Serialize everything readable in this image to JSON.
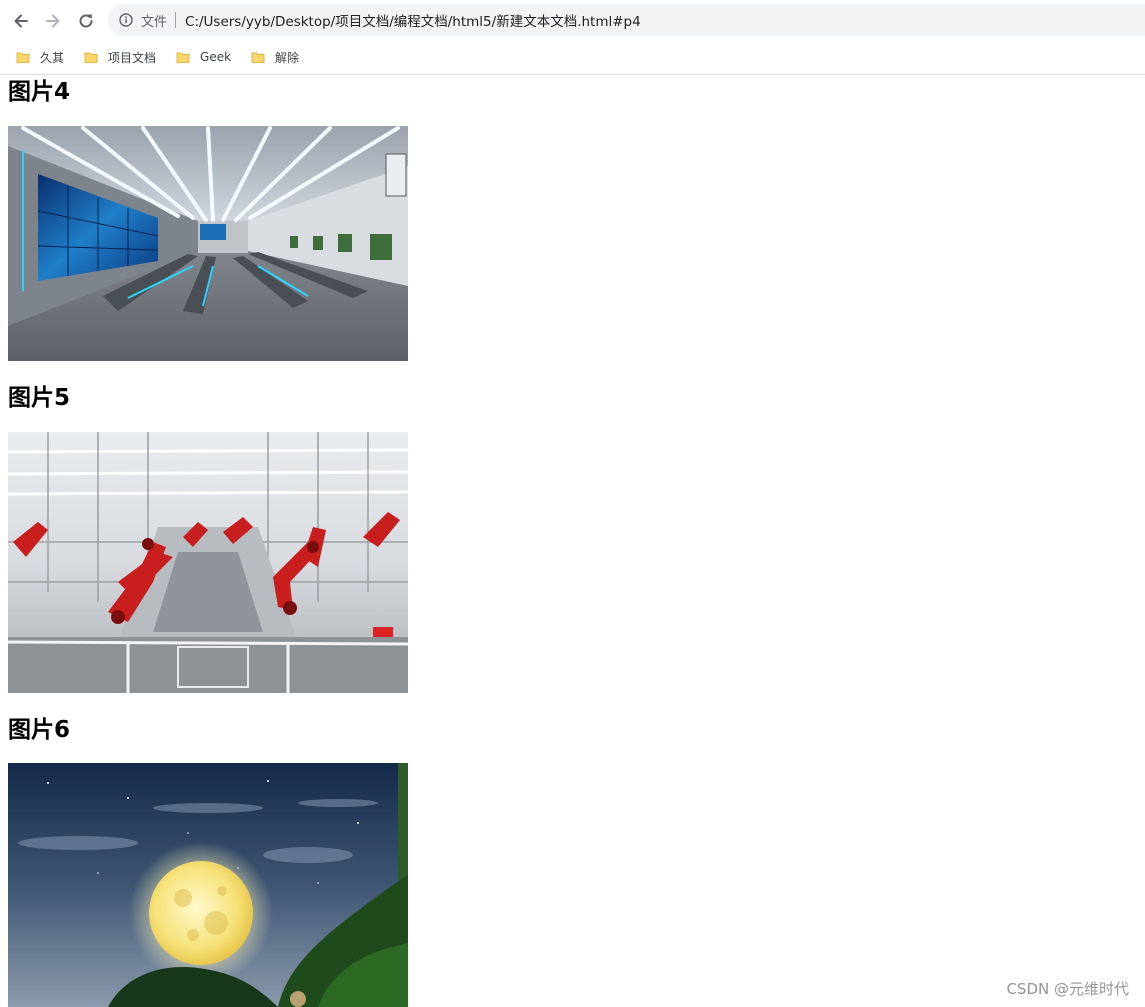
{
  "browser": {
    "scheme_label": "文件",
    "url": "C:/Users/yyb/Desktop/项目文档/编程文档/html5/新建文本文档.html#p4",
    "icons": {
      "back": "arrow-left-icon",
      "forward": "arrow-right-icon",
      "reload": "reload-icon",
      "info": "info-circle-icon",
      "folder": "folder-icon"
    },
    "bookmarks": [
      {
        "label": "久其"
      },
      {
        "label": "项目文档"
      },
      {
        "label": "Geek"
      },
      {
        "label": "解除"
      }
    ]
  },
  "page": {
    "sections": [
      {
        "heading": "图片4"
      },
      {
        "heading": "图片5"
      },
      {
        "heading": "图片6"
      }
    ]
  },
  "watermark": "CSDN @元维时代"
}
